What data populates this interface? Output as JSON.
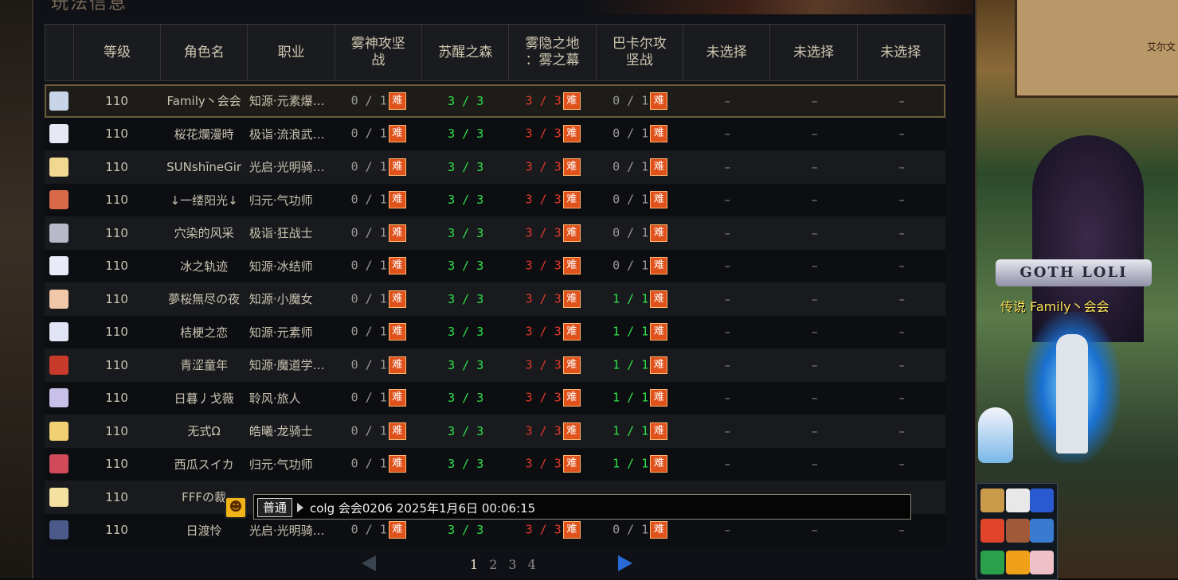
{
  "panel": {
    "title": "玩法信息"
  },
  "columns": [
    "",
    "等级",
    "角色名",
    "职业",
    "雾神攻坚\n战",
    "苏醒之森",
    "雾隐之地\n：雾之幕",
    "巴卡尔攻\n坚战",
    "未选择",
    "未选择",
    "未选择"
  ],
  "badge": "难",
  "dash": "–",
  "rows": [
    {
      "level": "110",
      "name": "Family丶会会",
      "job": "知源·元素爆…",
      "p1": "0 / 1",
      "p2": "3 / 3",
      "p3": "3 / 3",
      "p4": "0 / 1",
      "av": "#c8d4e8"
    },
    {
      "level": "110",
      "name": "桜花爛漫時",
      "job": "极诣·流浪武…",
      "p1": "0 / 1",
      "p2": "3 / 3",
      "p3": "3 / 3",
      "p4": "0 / 1",
      "av": "#e8e8f4"
    },
    {
      "level": "110",
      "name": "SUNshīneGir",
      "job": "光启·光明骑…",
      "p1": "0 / 1",
      "p2": "3 / 3",
      "p3": "3 / 3",
      "p4": "0 / 1",
      "av": "#f0d890"
    },
    {
      "level": "110",
      "name": "↓一缕阳光↓",
      "job": "归元·气功师",
      "p1": "0 / 1",
      "p2": "3 / 3",
      "p3": "3 / 3",
      "p4": "0 / 1",
      "av": "#d86a4a"
    },
    {
      "level": "110",
      "name": "穴染的风采",
      "job": "极诣·狂战士",
      "p1": "0 / 1",
      "p2": "3 / 3",
      "p3": "3 / 3",
      "p4": "0 / 1",
      "av": "#b8b8c8"
    },
    {
      "level": "110",
      "name": "冰之轨迹",
      "job": "知源·冰结师",
      "p1": "0 / 1",
      "p2": "3 / 3",
      "p3": "3 / 3",
      "p4": "0 / 1",
      "av": "#e8eaf8"
    },
    {
      "level": "110",
      "name": "夢桜無尽の夜",
      "job": "知源·小魔女",
      "p1": "0 / 1",
      "p2": "3 / 3",
      "p3": "3 / 3",
      "p4": "1 / 1",
      "av": "#f0c8a8"
    },
    {
      "level": "110",
      "name": "桔梗之恋",
      "job": "知源·元素师",
      "p1": "0 / 1",
      "p2": "3 / 3",
      "p3": "3 / 3",
      "p4": "1 / 1",
      "av": "#e0e4f4"
    },
    {
      "level": "110",
      "name": "青涩童年",
      "job": "知源·魔道学…",
      "p1": "0 / 1",
      "p2": "3 / 3",
      "p3": "3 / 3",
      "p4": "1 / 1",
      "av": "#c83a2a"
    },
    {
      "level": "110",
      "name": "日暮丿戈薇",
      "job": "聆风·旅人",
      "p1": "0 / 1",
      "p2": "3 / 3",
      "p3": "3 / 3",
      "p4": "1 / 1",
      "av": "#c8c0e8"
    },
    {
      "level": "110",
      "name": "无式Ω",
      "job": "皓曦·龙骑士",
      "p1": "0 / 1",
      "p2": "3 / 3",
      "p3": "3 / 3",
      "p4": "1 / 1",
      "av": "#f0d070"
    },
    {
      "level": "110",
      "name": "西瓜スイカ",
      "job": "归元·气功师",
      "p1": "0 / 1",
      "p2": "3 / 3",
      "p3": "3 / 3",
      "p4": "1 / 1",
      "av": "#d04a5a"
    },
    {
      "level": "110",
      "name": "FFFの裁",
      "job": "",
      "p1": "",
      "p2": "",
      "p3": "",
      "p4": "",
      "av": "#f4e0a0"
    },
    {
      "level": "110",
      "name": "日渡怜",
      "job": "光启·光明骑…",
      "p1": "0 / 1",
      "p2": "3 / 3",
      "p3": "3 / 3",
      "p4": "0 / 1",
      "av": "#4a5a8a"
    }
  ],
  "pager": {
    "pages": [
      "1",
      "2",
      "3",
      "4"
    ],
    "current": "1"
  },
  "chat": {
    "channel": "普通",
    "text": "colg 会会0206 2025年1月6日 00:06:15"
  },
  "scene": {
    "guild": "GOTH LOLI",
    "character": "传说 Family丶会会",
    "minimap_label": "艾尔文"
  },
  "colors": {
    "green": "#2ee04a",
    "red": "#e23a2a",
    "grey": "#9a9a94",
    "badge": "#e0521c"
  }
}
